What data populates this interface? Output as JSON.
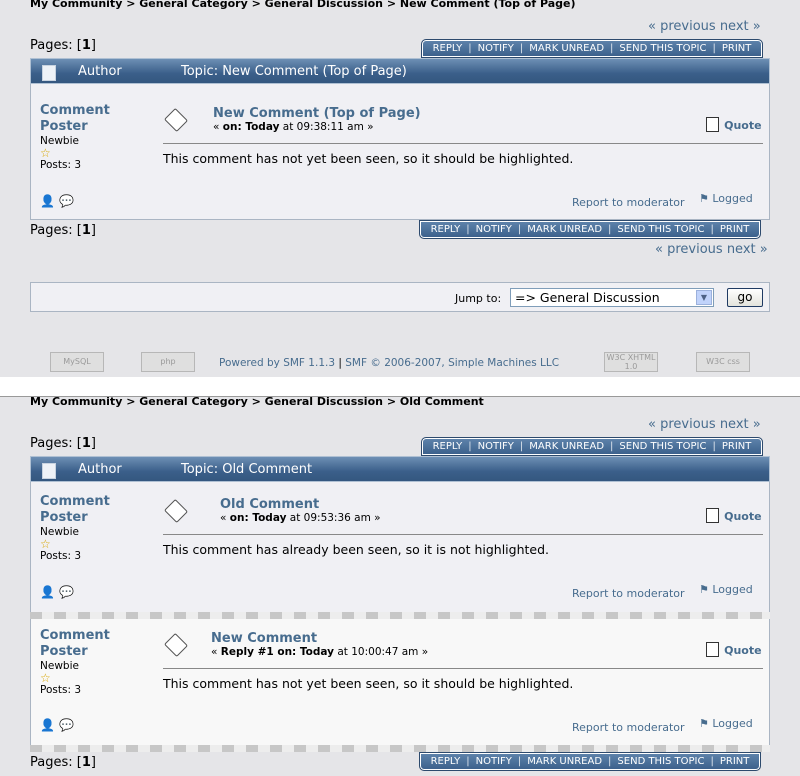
{
  "common": {
    "crumb_sep": ">",
    "prev_label": "« previous",
    "next_label": "next »",
    "pages_label": "Pages:",
    "pages_current": "1",
    "tabs": [
      "REPLY",
      "NOTIFY",
      "MARK UNREAD",
      "SEND THIS TOPIC",
      "PRINT"
    ],
    "author_label": "Author",
    "quote_label": "Quote",
    "report_label": "Report to moderator",
    "logged_label": "Logged",
    "poster": {
      "name_line1": "Comment",
      "name_line2": "Poster",
      "rank": "Newbie",
      "posts": "Posts: 3"
    }
  },
  "top": {
    "breadcrumb": [
      "My Community",
      "General Category",
      "General Discussion",
      "New Comment (Top of Page)"
    ],
    "topic_title": "Topic: New Comment (Top of Page)",
    "post": {
      "subject": "New Comment (Top of Page)",
      "meta_prefix": "«",
      "meta_on": "on: Today",
      "meta_time": "at 09:38:11 am »",
      "body": "This comment has not yet been seen, so it should be highlighted."
    },
    "jump": {
      "label": "Jump to:",
      "selected": "=> General Discussion",
      "go_label": "go"
    },
    "footer": {
      "powered_by": "Powered by SMF 1.1.3",
      "pipe": "|",
      "copyright": "SMF © 2006-2007, Simple Machines LLC",
      "badge_mysql": "MySQL",
      "badge_php": "php",
      "badge_xhtml": "W3C XHTML 1.0",
      "badge_css": "W3C css"
    }
  },
  "bottom": {
    "breadcrumb": [
      "My Community",
      "General Category",
      "General Discussion",
      "Old Comment"
    ],
    "topic_title": "Topic: Old Comment",
    "posts": [
      {
        "subject": "Old Comment",
        "meta_prefix": "«",
        "meta_on": "on: Today",
        "meta_time": "at 09:53:36 am »",
        "body": "This comment has already been seen, so it is not highlighted."
      },
      {
        "subject": "New Comment",
        "meta_prefix": "«",
        "meta_on": "Reply #1 on: Today",
        "meta_time": "at 10:00:47 am »",
        "body": "This comment has not yet been seen, so it should be highlighted."
      }
    ]
  }
}
